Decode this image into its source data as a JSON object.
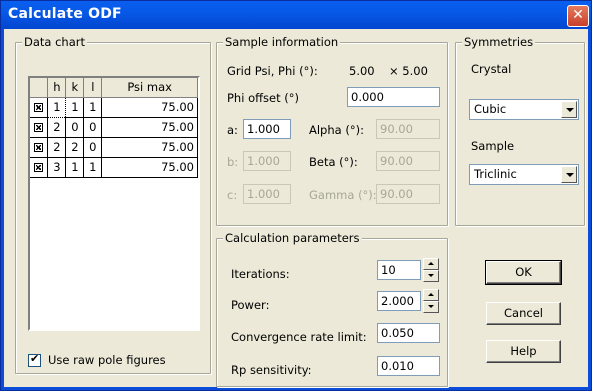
{
  "window": {
    "title": "Calculate ODF",
    "close_glyph": "✕"
  },
  "data_chart": {
    "label": "Data chart",
    "headers": [
      "",
      "h",
      "k",
      "l",
      "Psi max"
    ],
    "rows": [
      {
        "selected": true,
        "h": "1",
        "k": "1",
        "l": "1",
        "psi_max": "75.00"
      },
      {
        "selected": true,
        "h": "2",
        "k": "0",
        "l": "0",
        "psi_max": "75.00"
      },
      {
        "selected": true,
        "h": "2",
        "k": "2",
        "l": "0",
        "psi_max": "75.00"
      },
      {
        "selected": true,
        "h": "3",
        "k": "1",
        "l": "1",
        "psi_max": "75.00"
      }
    ],
    "use_raw_label": "Use raw pole figures",
    "use_raw_checked": true
  },
  "sample_info": {
    "label": "Sample information",
    "grid_label": "Grid Psi, Phi (°):",
    "grid_psi": "5.00",
    "grid_x": "× 5.00",
    "phi_offset_label": "Phi offset (°)",
    "phi_offset_value": "0.000",
    "a_label": "a:",
    "a_value": "1.000",
    "b_label": "b:",
    "b_value": "1.000",
    "c_label": "c:",
    "c_value": "1.000",
    "alpha_label": "Alpha (°):",
    "alpha_value": "90.00",
    "beta_label": "Beta (°):",
    "beta_value": "90.00",
    "gamma_label": "Gamma (°):",
    "gamma_value": "90.00"
  },
  "symmetries": {
    "label": "Symmetries",
    "crystal_label": "Crystal",
    "crystal_value": "Cubic",
    "sample_label": "Sample",
    "sample_value": "Triclinic"
  },
  "calc_params": {
    "label": "Calculation parameters",
    "iterations_label": "Iterations:",
    "iterations_value": "10",
    "power_label": "Power:",
    "power_value": "2.000",
    "conv_label": "Convergence rate limit:",
    "conv_value": "0.050",
    "rp_label": "Rp  sensitivity:",
    "rp_value": "0.010"
  },
  "buttons": {
    "ok": "OK",
    "cancel": "Cancel",
    "help": "Help"
  }
}
